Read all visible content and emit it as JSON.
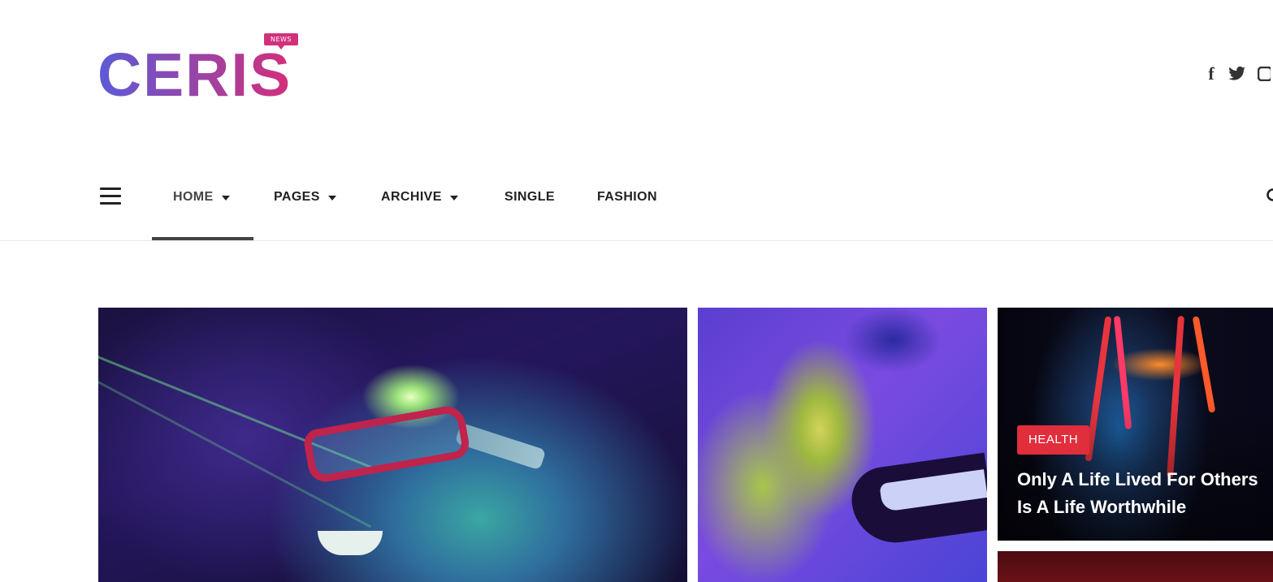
{
  "brand": {
    "logo_text": "CERIS",
    "logo_badge": "NEWS",
    "gradient_start": "#5b5bd6",
    "gradient_end": "#d42e7a"
  },
  "social": {
    "icons": [
      "facebook-icon",
      "twitter-icon",
      "instagram-icon"
    ]
  },
  "nav": {
    "items": [
      {
        "label": "HOME",
        "has_dropdown": true,
        "active": true
      },
      {
        "label": "PAGES",
        "has_dropdown": true,
        "active": false
      },
      {
        "label": "ARCHIVE",
        "has_dropdown": true,
        "active": false
      },
      {
        "label": "SINGLE",
        "has_dropdown": false,
        "active": false
      },
      {
        "label": "FASHION",
        "has_dropdown": false,
        "active": false
      }
    ]
  },
  "featured": {
    "posts": [
      {
        "category": "",
        "title": ""
      },
      {
        "category": "",
        "title": ""
      },
      {
        "category": "HEALTH",
        "title": "Only A Life Lived For Others Is A Life Worthwhile",
        "category_color": "#e02e3c"
      },
      {
        "category": "",
        "title": ""
      }
    ]
  }
}
